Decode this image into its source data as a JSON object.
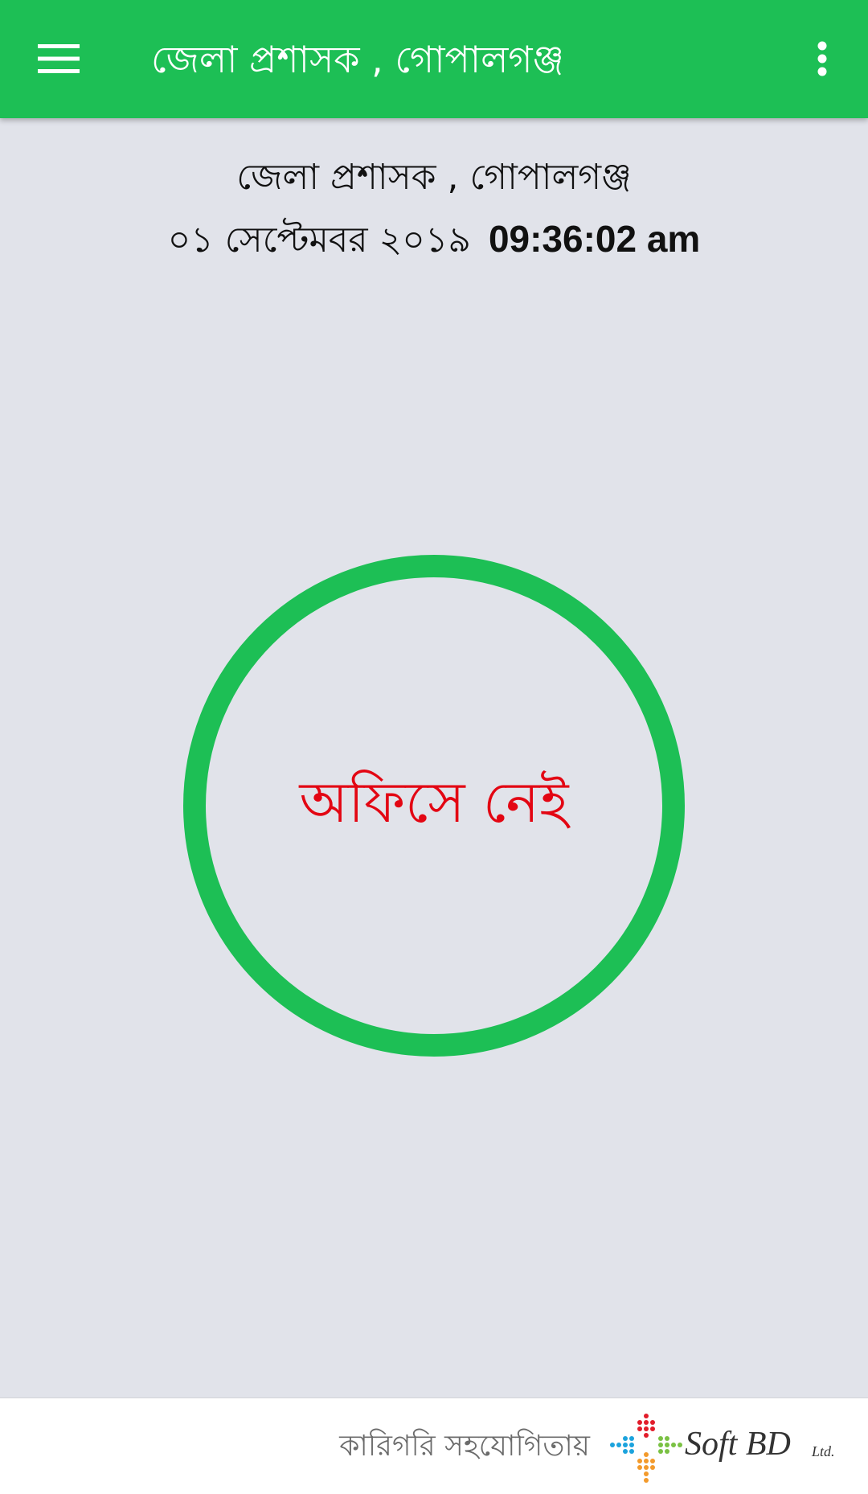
{
  "app_bar": {
    "title": "জেলা  প্রশাসক , গোপালগঞ্জ",
    "menu_icon": "hamburger-menu-icon",
    "overflow_icon": "more-vert-icon"
  },
  "header": {
    "office_name": "জেলা  প্রশাসক , গোপালগঞ্জ",
    "date": "০১ সেপ্টেমবর ২০১৯",
    "time": "09:36:02 am"
  },
  "status": {
    "label": "অফিসে নেই"
  },
  "footer": {
    "label": "কারিগরি সহযোগিতায়",
    "logo_text": "Soft BD",
    "logo_suffix": "Ltd."
  },
  "colors": {
    "primary_green": "#1dbf55",
    "status_red": "#e30613",
    "background": "#e1e3ea"
  }
}
